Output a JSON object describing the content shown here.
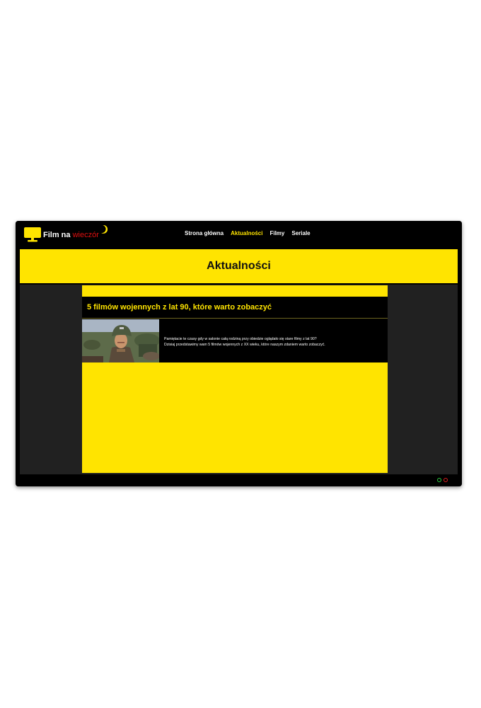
{
  "brand": {
    "name_main": "Film na",
    "name_accent": "wieczór",
    "logo_icon": "monitor-icon",
    "moon_icon": "crescent-moon-icon"
  },
  "nav": {
    "items": [
      {
        "label": "Strona główna",
        "active": false
      },
      {
        "label": "Aktualności",
        "active": true
      },
      {
        "label": "Filmy",
        "active": false
      },
      {
        "label": "Seriale",
        "active": false
      }
    ]
  },
  "page": {
    "title": "Aktualności"
  },
  "article": {
    "title": "5 filmów wojennych z lat 90, które warto zobaczyć",
    "thumbnail": "soldier-helmet-thumbnail",
    "lines": [
      "Pamiętacie te czasy gdy w salonie całą rodziną przy obiedzie oglądało się stare filmy z lat 90?",
      "Dzisiaj przedstawimy wam 5 filmów wojennych z XX wieku, które naszym zdaniem warto zobaczyć."
    ]
  },
  "colors": {
    "accent": "#FFE400",
    "background": "#000000",
    "content_bg": "#212121",
    "brand_red": "#e01010"
  },
  "status_dots": [
    "green-dot",
    "red-dot"
  ]
}
